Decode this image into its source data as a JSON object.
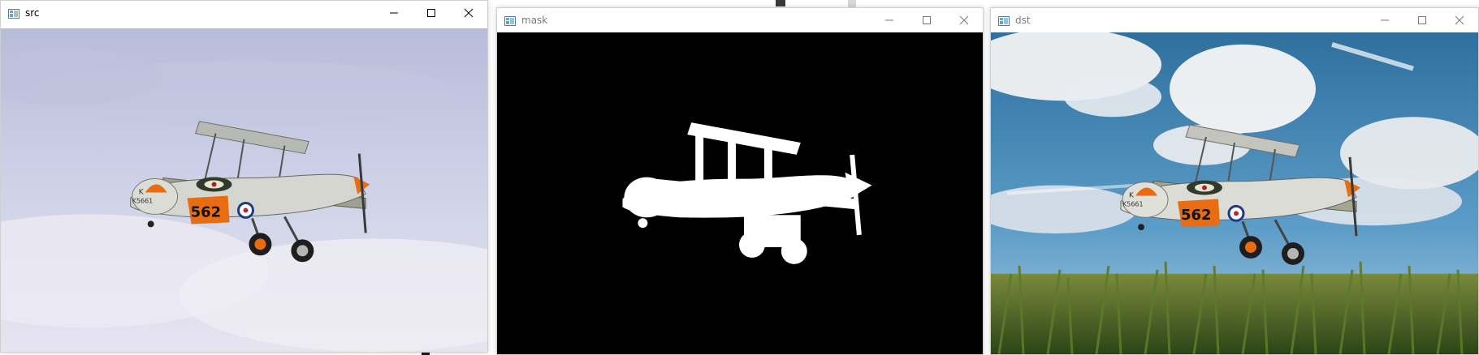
{
  "windows": {
    "src": {
      "title": "src",
      "tail_number": "562",
      "tail_letter": "K",
      "tail_serial": "K5661"
    },
    "mask": {
      "title": "mask"
    },
    "dst": {
      "title": "dst",
      "tail_number": "562",
      "tail_letter": "K",
      "tail_serial": "K5661"
    }
  },
  "icons": {
    "app": "app-window-icon",
    "minimize": "minimize-icon",
    "maximize": "maximize-icon",
    "close": "close-icon"
  },
  "colors": {
    "sky_src": "#ccd0e8",
    "mask_bg": "#000000",
    "mask_fg": "#ffffff",
    "sky_dst": "#3d86b8",
    "field_dst": "#3f5e22",
    "plane_orange": "#e86d12"
  }
}
